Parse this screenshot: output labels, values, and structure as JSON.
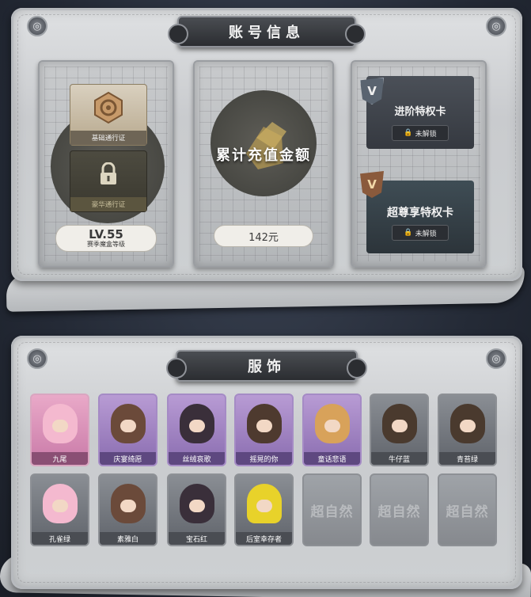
{
  "account": {
    "title": "账号信息",
    "pass": {
      "basic_label": "基础通行证",
      "deluxe_label": "豪华通行证",
      "level": "LV.55",
      "level_caption": "赛季魔盒等级"
    },
    "recharge": {
      "title": "累计充值金额",
      "amount": "142元"
    },
    "privileges": [
      {
        "name": "进阶特权卡",
        "badge": "V",
        "status": "未解锁"
      },
      {
        "name": "超尊享特权卡",
        "badge": "V",
        "status": "未解锁"
      }
    ]
  },
  "costumes": {
    "title": "服饰",
    "row1": [
      {
        "name": "九尾",
        "rarity": "pink"
      },
      {
        "name": "庆宴绮愿",
        "rarity": "purple",
        "tag": ""
      },
      {
        "name": "丝绒哀歌",
        "rarity": "purple"
      },
      {
        "name": "摇晃的你",
        "rarity": "purple"
      },
      {
        "name": "童话悲语",
        "rarity": "purple"
      },
      {
        "name": "牛仔蓝",
        "rarity": "grey"
      },
      {
        "name": "青苔绿",
        "rarity": "grey"
      }
    ],
    "row2": [
      {
        "name": "孔雀绿",
        "rarity": "grey"
      },
      {
        "name": "素雅白",
        "rarity": "grey"
      },
      {
        "name": "宝石红",
        "rarity": "grey"
      },
      {
        "name": "后室幸存者",
        "rarity": "grey"
      },
      {
        "name": "",
        "rarity": "empty",
        "placeholder": "超自然"
      },
      {
        "name": "",
        "rarity": "empty",
        "placeholder": "超自然"
      },
      {
        "name": "",
        "rarity": "empty",
        "placeholder": "超自然"
      }
    ]
  },
  "colors": {
    "frame": "#cdd0d2",
    "plate": "#2b2d31",
    "pink_rarity": "#e9a9c8",
    "purple_rarity": "#b89bd4"
  }
}
